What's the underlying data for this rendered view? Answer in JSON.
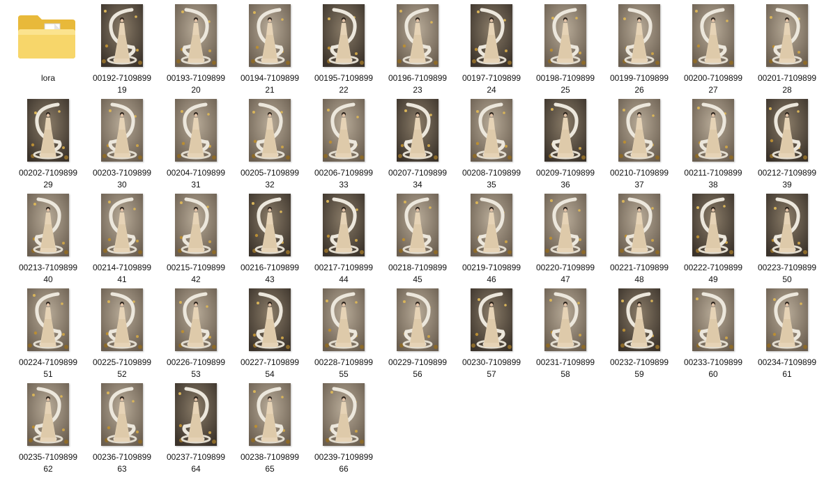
{
  "explorer": {
    "folder": {
      "name": "lora",
      "icon": "folder-icon"
    },
    "file_icon": "image-thumbnail-icon",
    "colors": {
      "folder_back": "#e8b93a",
      "folder_front": "#f7d66a",
      "thumb_bg_dark": "#4a4036",
      "thumb_bg_light": "#b8ab98",
      "dress": "#e6d3b6",
      "snake": "#e9e4d8",
      "gold": "#c9a24a"
    },
    "files": [
      {
        "line1": "00192-7109899",
        "line2": "19"
      },
      {
        "line1": "00193-7109899",
        "line2": "20"
      },
      {
        "line1": "00194-7109899",
        "line2": "21"
      },
      {
        "line1": "00195-7109899",
        "line2": "22"
      },
      {
        "line1": "00196-7109899",
        "line2": "23"
      },
      {
        "line1": "00197-7109899",
        "line2": "24"
      },
      {
        "line1": "00198-7109899",
        "line2": "25"
      },
      {
        "line1": "00199-7109899",
        "line2": "26"
      },
      {
        "line1": "00200-7109899",
        "line2": "27"
      },
      {
        "line1": "00201-7109899",
        "line2": "28"
      },
      {
        "line1": "00202-7109899",
        "line2": "29"
      },
      {
        "line1": "00203-7109899",
        "line2": "30"
      },
      {
        "line1": "00204-7109899",
        "line2": "31"
      },
      {
        "line1": "00205-7109899",
        "line2": "32"
      },
      {
        "line1": "00206-7109899",
        "line2": "33"
      },
      {
        "line1": "00207-7109899",
        "line2": "34"
      },
      {
        "line1": "00208-7109899",
        "line2": "35"
      },
      {
        "line1": "00209-7109899",
        "line2": "36"
      },
      {
        "line1": "00210-7109899",
        "line2": "37"
      },
      {
        "line1": "00211-7109899",
        "line2": "38"
      },
      {
        "line1": "00212-7109899",
        "line2": "39"
      },
      {
        "line1": "00213-7109899",
        "line2": "40"
      },
      {
        "line1": "00214-7109899",
        "line2": "41"
      },
      {
        "line1": "00215-7109899",
        "line2": "42"
      },
      {
        "line1": "00216-7109899",
        "line2": "43"
      },
      {
        "line1": "00217-7109899",
        "line2": "44"
      },
      {
        "line1": "00218-7109899",
        "line2": "45"
      },
      {
        "line1": "00219-7109899",
        "line2": "46"
      },
      {
        "line1": "00220-7109899",
        "line2": "47"
      },
      {
        "line1": "00221-7109899",
        "line2": "48"
      },
      {
        "line1": "00222-7109899",
        "line2": "49"
      },
      {
        "line1": "00223-7109899",
        "line2": "50"
      },
      {
        "line1": "00224-7109899",
        "line2": "51"
      },
      {
        "line1": "00225-7109899",
        "line2": "52"
      },
      {
        "line1": "00226-7109899",
        "line2": "53"
      },
      {
        "line1": "00227-7109899",
        "line2": "54"
      },
      {
        "line1": "00228-7109899",
        "line2": "55"
      },
      {
        "line1": "00229-7109899",
        "line2": "56"
      },
      {
        "line1": "00230-7109899",
        "line2": "57"
      },
      {
        "line1": "00231-7109899",
        "line2": "58"
      },
      {
        "line1": "00232-7109899",
        "line2": "59"
      },
      {
        "line1": "00233-7109899",
        "line2": "60"
      },
      {
        "line1": "00234-7109899",
        "line2": "61"
      },
      {
        "line1": "00235-7109899",
        "line2": "62"
      },
      {
        "line1": "00236-7109899",
        "line2": "63"
      },
      {
        "line1": "00237-7109899",
        "line2": "64"
      },
      {
        "line1": "00238-7109899",
        "line2": "65"
      },
      {
        "line1": "00239-7109899",
        "line2": "66"
      }
    ]
  }
}
